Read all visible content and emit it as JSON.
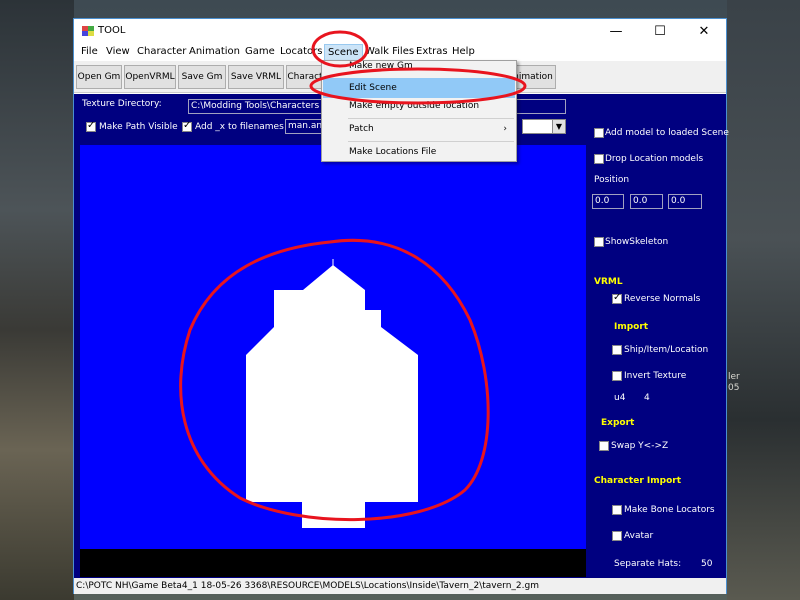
{
  "window": {
    "title": "TOOL",
    "controls": {
      "minimize": "—",
      "maximize": "☐",
      "close": "✕"
    }
  },
  "menu": [
    "File",
    "View",
    "Character",
    "Animation",
    "Game",
    "Locators",
    "Scene",
    "Walk Files",
    "Extras",
    "Help"
  ],
  "toolbar": [
    "Open Gm",
    "OpenVRML",
    "Save Gm",
    "Save VRML",
    "Charact",
    "nimation"
  ],
  "texture": {
    "label": "Texture Directory:",
    "path": "C:\\Modding Tools\\Characters tga",
    "make_path_visible": "Make Path Visible",
    "add_x": "Add _x to filenames",
    "dropdown_value": "man.an"
  },
  "scene_menu": {
    "items": [
      "Make new Gm",
      "Edit Scene",
      "Make empty outside location",
      "Patch",
      "Make Locations File"
    ],
    "highlighted": "Edit Scene"
  },
  "right_panel": {
    "add_model": "Add model to loaded Scene",
    "drop_location": "Drop Location models",
    "position_label": "Position",
    "position": [
      "0.0",
      "0.0",
      "0.0"
    ],
    "show_skeleton": "ShowSkeleton",
    "vrml_heading": "VRML",
    "reverse_normals": "Reverse Normals",
    "import_heading": "Import",
    "ship_item_location": "Ship/Item/Location",
    "invert_texture": "Invert Texture",
    "u_label": "u4",
    "u_value": "4",
    "export_heading": "Export",
    "swap_yz": "Swap  Y<->Z",
    "character_import_heading": "Character Import",
    "make_bone_locators": "Make Bone Locators",
    "avatar": "Avatar",
    "separate_hats_label": "Separate Hats:",
    "separate_hats_value": "50"
  },
  "status": "C:\\POTC NH\\Game Beta4_1 18-05-26 3368\\RESOURCE\\MODELS\\Locations\\Inside\\Tavern_2\\tavern_2.gm",
  "background_text": [
    "ler",
    "05"
  ],
  "colors": {
    "panel": "#000080",
    "viewport": "#0000ff",
    "highlight": "#91c9f7",
    "annotation": "#e8141e"
  }
}
